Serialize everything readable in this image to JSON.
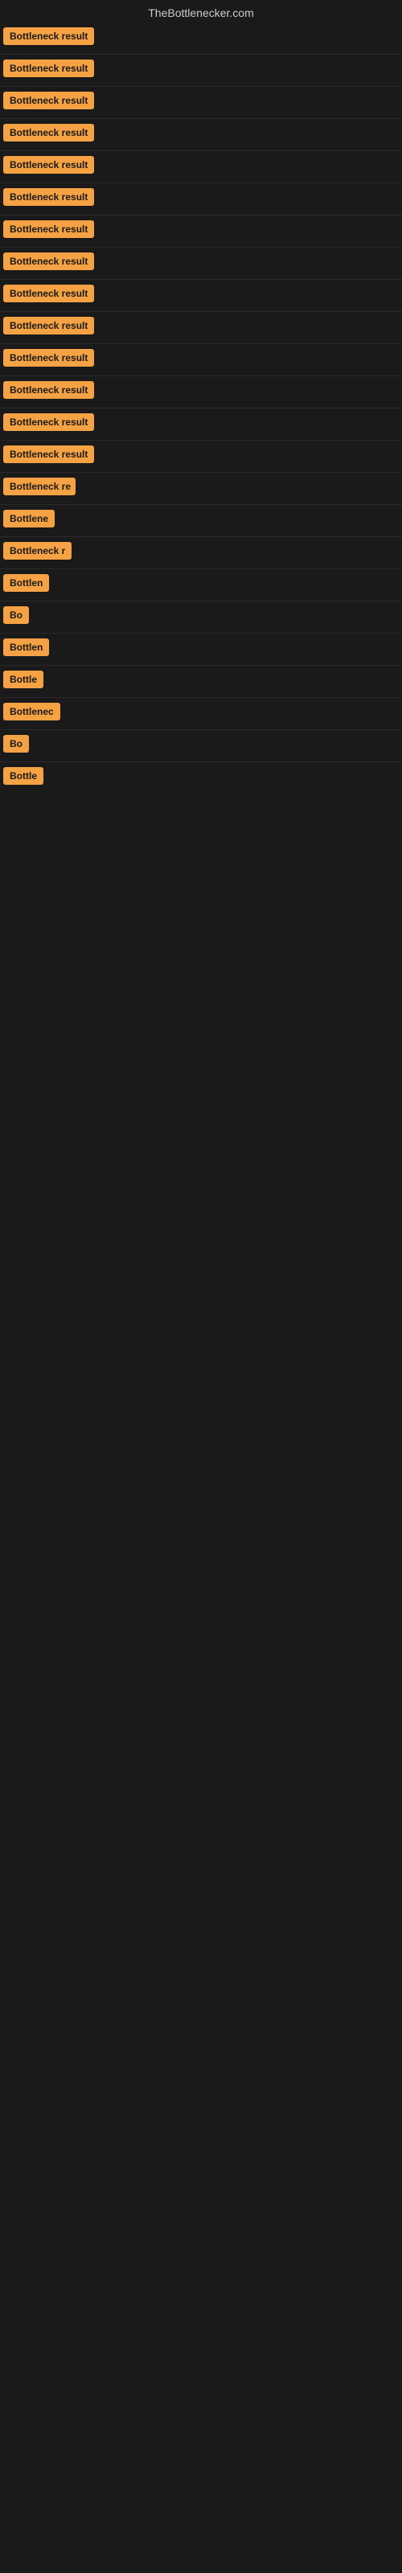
{
  "site": {
    "title": "TheBottlenecker.com"
  },
  "rows": [
    {
      "id": 1,
      "label": "Bottleneck result",
      "truncated": false
    },
    {
      "id": 2,
      "label": "Bottleneck result",
      "truncated": false
    },
    {
      "id": 3,
      "label": "Bottleneck result",
      "truncated": false
    },
    {
      "id": 4,
      "label": "Bottleneck result",
      "truncated": false
    },
    {
      "id": 5,
      "label": "Bottleneck result",
      "truncated": false
    },
    {
      "id": 6,
      "label": "Bottleneck result",
      "truncated": false
    },
    {
      "id": 7,
      "label": "Bottleneck result",
      "truncated": false
    },
    {
      "id": 8,
      "label": "Bottleneck result",
      "truncated": false
    },
    {
      "id": 9,
      "label": "Bottleneck result",
      "truncated": false
    },
    {
      "id": 10,
      "label": "Bottleneck result",
      "truncated": false
    },
    {
      "id": 11,
      "label": "Bottleneck result",
      "truncated": false
    },
    {
      "id": 12,
      "label": "Bottleneck result",
      "truncated": false
    },
    {
      "id": 13,
      "label": "Bottleneck result",
      "truncated": false
    },
    {
      "id": 14,
      "label": "Bottleneck result",
      "truncated": false
    },
    {
      "id": 15,
      "label": "Bottleneck re",
      "truncated": true,
      "width": 90
    },
    {
      "id": 16,
      "label": "Bottlene",
      "truncated": true,
      "width": 72
    },
    {
      "id": 17,
      "label": "Bottleneck r",
      "truncated": true,
      "width": 85
    },
    {
      "id": 18,
      "label": "Bottlen",
      "truncated": true,
      "width": 63
    },
    {
      "id": 19,
      "label": "Bo",
      "truncated": true,
      "width": 32
    },
    {
      "id": 20,
      "label": "Bottlen",
      "truncated": true,
      "width": 63
    },
    {
      "id": 21,
      "label": "Bottle",
      "truncated": true,
      "width": 52
    },
    {
      "id": 22,
      "label": "Bottlenec",
      "truncated": true,
      "width": 78
    },
    {
      "id": 23,
      "label": "Bo",
      "truncated": true,
      "width": 32
    },
    {
      "id": 24,
      "label": "Bottle",
      "truncated": true,
      "width": 52
    }
  ],
  "colors": {
    "badge_bg": "#f5a244",
    "badge_text": "#1a1a1a",
    "page_bg": "#1a1a1a",
    "title_text": "#cccccc"
  }
}
